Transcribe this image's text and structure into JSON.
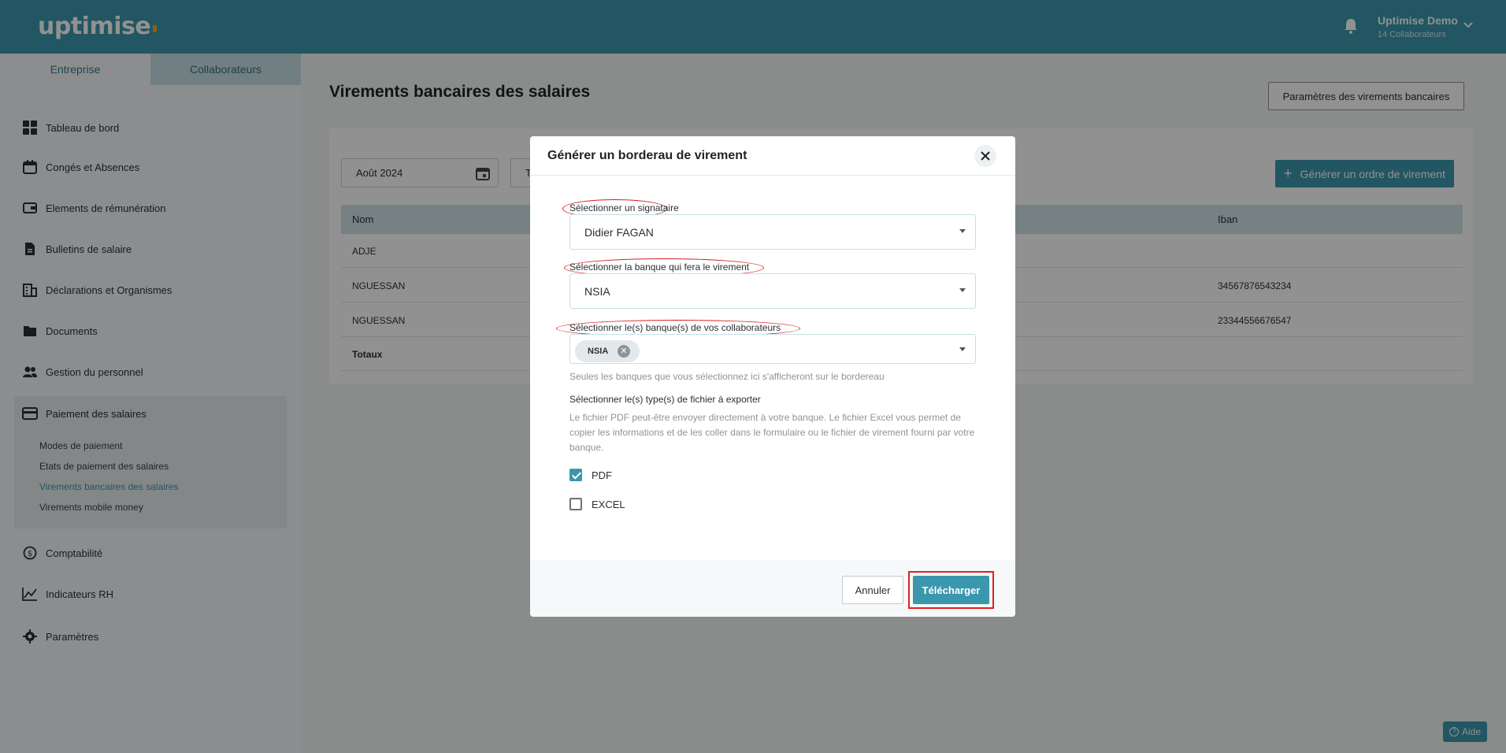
{
  "header": {
    "logo": "uptimise",
    "user_name": "Uptimise Demo",
    "user_sub": "14 Collaborateurs"
  },
  "sidebar": {
    "tabs": [
      "Entreprise",
      "Collaborateurs"
    ],
    "items": [
      {
        "label": "Tableau de bord",
        "icon": "dashboard-icon"
      },
      {
        "label": "Congés et Absences",
        "icon": "calendar-icon"
      },
      {
        "label": "Elements de rémunération",
        "icon": "wallet-icon"
      },
      {
        "label": "Bulletins de salaire",
        "icon": "document-icon"
      },
      {
        "label": "Déclarations et Organismes",
        "icon": "building-icon"
      },
      {
        "label": "Documents",
        "icon": "folder-icon"
      },
      {
        "label": "Gestion du personnel",
        "icon": "people-icon"
      },
      {
        "label": "Paiement des salaires",
        "icon": "card-icon"
      },
      {
        "label": "Comptabilité",
        "icon": "dollar-icon"
      },
      {
        "label": "Indicateurs RH",
        "icon": "chart-icon"
      },
      {
        "label": "Paramètres",
        "icon": "gear-icon"
      }
    ],
    "subitems": [
      "Modes de paiement",
      "Etats de paiement des salaires",
      "Virements bancaires des salaires",
      "Virements mobile money"
    ]
  },
  "main": {
    "title": "Virements bancaires des salaires",
    "params_button": "Paramètres des virements bancaires",
    "date_value": "Août 2024",
    "second_input": "T",
    "generate_button": "Générer un ordre de virement",
    "columns": [
      "Nom",
      "Iban"
    ],
    "rows": [
      {
        "name": "ADJE",
        "iban": ""
      },
      {
        "name": "NGUESSAN",
        "iban": "34567876543234"
      },
      {
        "name": "NGUESSAN",
        "iban": "23344556676547"
      }
    ],
    "total_label": "Totaux"
  },
  "help": "Aide",
  "modal": {
    "title": "Générer un borderau de virement",
    "signataire_label": "Sélectionner un signataire",
    "signataire_value": "Didier FAGAN",
    "banque_label": "Sélectionner la banque qui fera le virement",
    "banque_value": "NSIA",
    "collab_label": "Sélectionner le(s) banque(s) de vos collaborateurs",
    "collab_chip": "NSIA",
    "collab_hint": "Seules les banques que vous sélectionnez ici s'afficheront sur le bordereau",
    "types_label": "Sélectionner le(s) type(s) de fichier à exporter",
    "types_hint": "Le fichier PDF peut-être envoyer directement à votre banque. Le fichier Excel vous permet de copier les informations et de les coller dans le formulaire ou le fichier de virement fourni par votre banque.",
    "opt_pdf": "PDF",
    "opt_pdf_checked": true,
    "opt_excel": "EXCEL",
    "opt_excel_checked": false,
    "cancel": "Annuler",
    "download": "Télécharger"
  },
  "colors": {
    "accent": "#3b97ad",
    "highlight": "#e02020"
  }
}
